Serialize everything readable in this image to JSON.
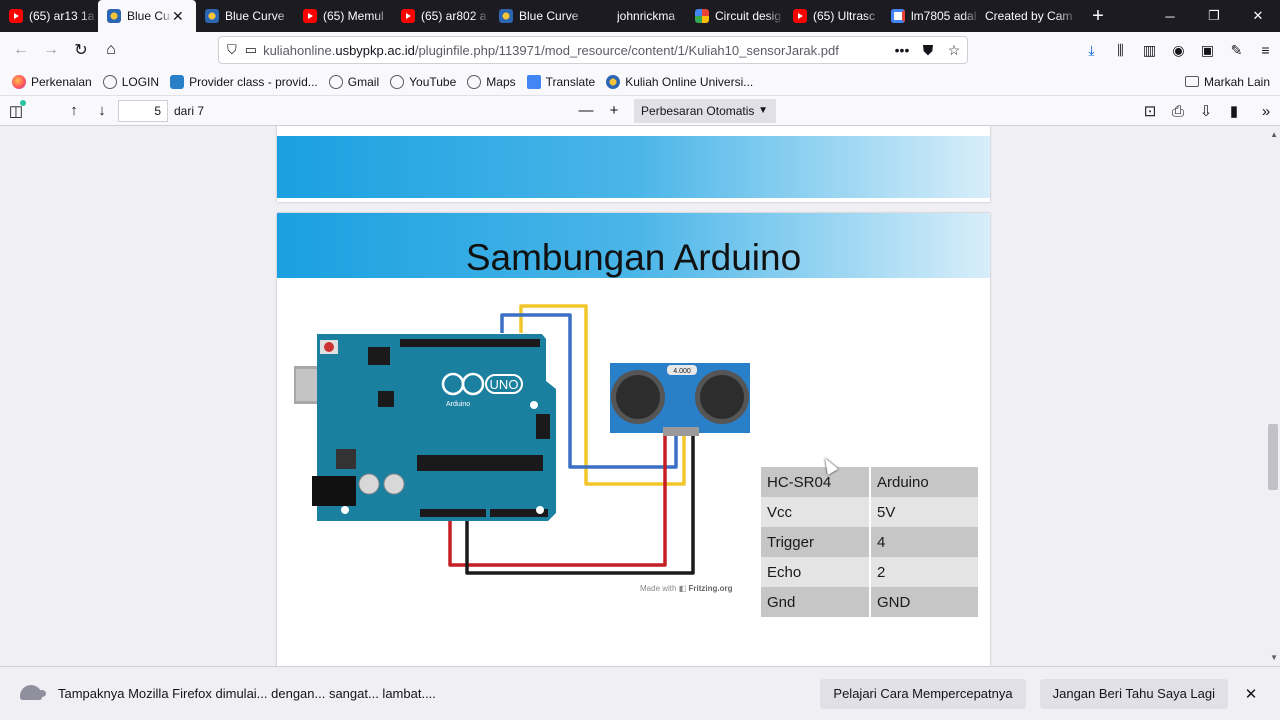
{
  "browser": {
    "tabs": [
      {
        "label": "(65) ar13 1a",
        "icon": "youtube-icon"
      },
      {
        "label": "Blue Curve",
        "icon": "university-icon",
        "active": true
      },
      {
        "label": "Blue Curve",
        "icon": "university-icon"
      },
      {
        "label": "(65) Memul",
        "icon": "youtube-icon"
      },
      {
        "label": "(65) ar802 a",
        "icon": "youtube-icon"
      },
      {
        "label": "Blue Curve",
        "icon": "university-icon"
      },
      {
        "label": "johnrickma",
        "icon": "blank-icon"
      },
      {
        "label": "Circuit desig",
        "icon": "grid-app-icon"
      },
      {
        "label": "(65) Ultrasc",
        "icon": "youtube-icon"
      },
      {
        "label": "lm7805 adal",
        "icon": "google-icon"
      },
      {
        "label": "Created by Cam",
        "icon": "blank-icon"
      }
    ],
    "url_prefix": "kuliahonline.",
    "url_domain": "usbypkp.ac.id",
    "url_path": "/pluginfile.php/113971/mod_resource/content/1/Kuliah10_sensorJarak.pdf",
    "bookmarks": [
      {
        "label": "Perkenalan",
        "icon": "firefox-icon"
      },
      {
        "label": "LOGIN",
        "icon": "globe-icon"
      },
      {
        "label": "Provider class - provid...",
        "icon": "provider-icon"
      },
      {
        "label": "Gmail",
        "icon": "globe-icon"
      },
      {
        "label": "YouTube",
        "icon": "globe-icon"
      },
      {
        "label": "Maps",
        "icon": "globe-icon"
      },
      {
        "label": "Translate",
        "icon": "translate-icon"
      },
      {
        "label": "Kuliah Online Universi...",
        "icon": "university-icon"
      }
    ],
    "other_bookmarks": "Markah Lain"
  },
  "pdf": {
    "page_number": "5",
    "page_total_label": "dari 7",
    "zoom": "Perbesaran Otomatis"
  },
  "slide": {
    "title": "Sambungan Arduino",
    "board_logo": "UNO",
    "board_name": "Arduino",
    "sensor_crystal": "4.000",
    "credit_prefix": "Made with",
    "credit_brand": "Fritzing.org",
    "table": {
      "header": [
        "HC-SR04",
        "Arduino"
      ],
      "rows": [
        [
          "Vcc",
          "5V"
        ],
        [
          "Trigger",
          "4"
        ],
        [
          "Echo",
          "2"
        ],
        [
          "Gnd",
          "GND"
        ]
      ]
    },
    "colors": {
      "banner": "#1aa0e0",
      "board": "#1b7fa0",
      "sensor": "#2a7fc9"
    }
  },
  "notification": {
    "message": "Tampaknya Mozilla Firefox dimulai... dengan... sangat... lambat....",
    "learn_button": "Pelajari Cara Mempercepatnya",
    "dismiss_button": "Jangan Beri Tahu Saya Lagi"
  }
}
